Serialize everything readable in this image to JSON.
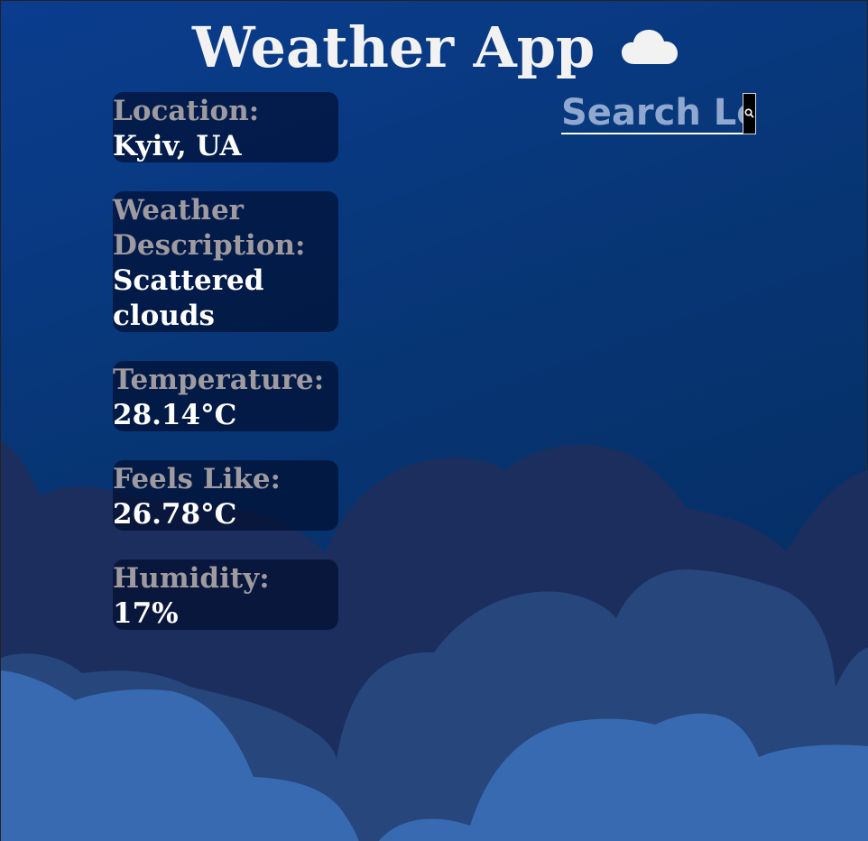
{
  "header": {
    "title": "Weather App",
    "icon": "cloud-icon"
  },
  "search": {
    "placeholder": "Search Location",
    "button_icon": "search-icon"
  },
  "weather": {
    "location_label": "Location:",
    "location_value": "Kyiv, UA",
    "description_label": "Weather Description:",
    "description_value": "Scattered clouds",
    "temperature_label": "Temperature:",
    "temperature_value": "28.14°C",
    "feels_like_label": "Feels Like:",
    "feels_like_value": "26.78°C",
    "humidity_label": "Humidity:",
    "humidity_value": "17%"
  },
  "colors": {
    "background": "#073573",
    "cloud_dark": "#1b2e5e",
    "cloud_mid": "#26467c",
    "cloud_light": "#376ab0",
    "label_text": "#9e9a9f",
    "value_text": "#ffffff"
  }
}
